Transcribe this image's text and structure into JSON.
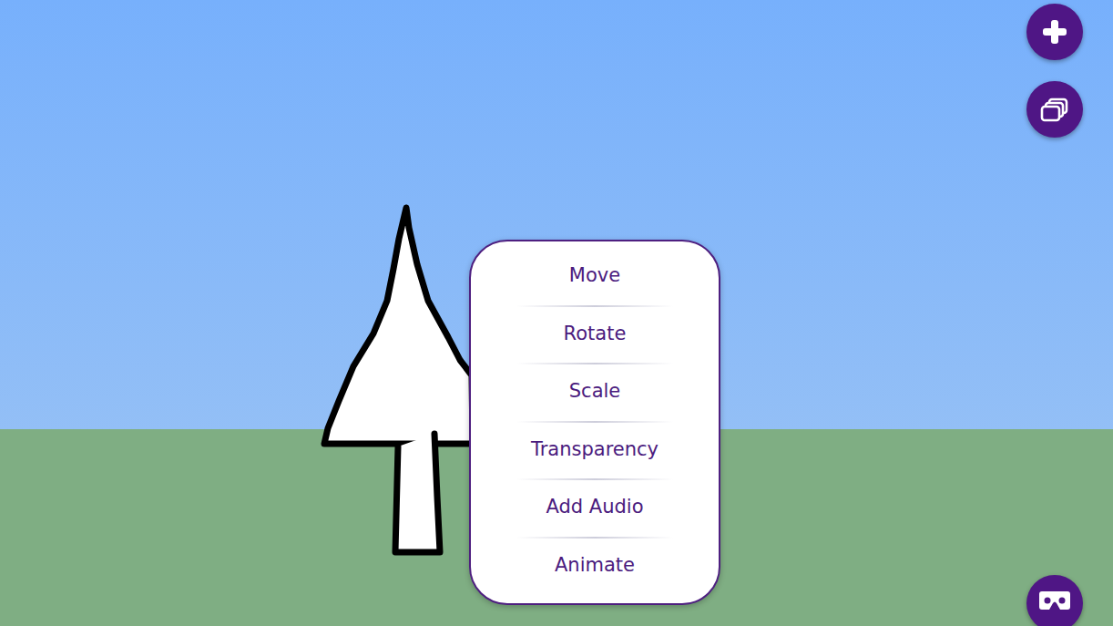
{
  "menu": {
    "items": [
      "Move",
      "Rotate",
      "Scale",
      "Transparency",
      "Add Audio",
      "Animate"
    ]
  }
}
